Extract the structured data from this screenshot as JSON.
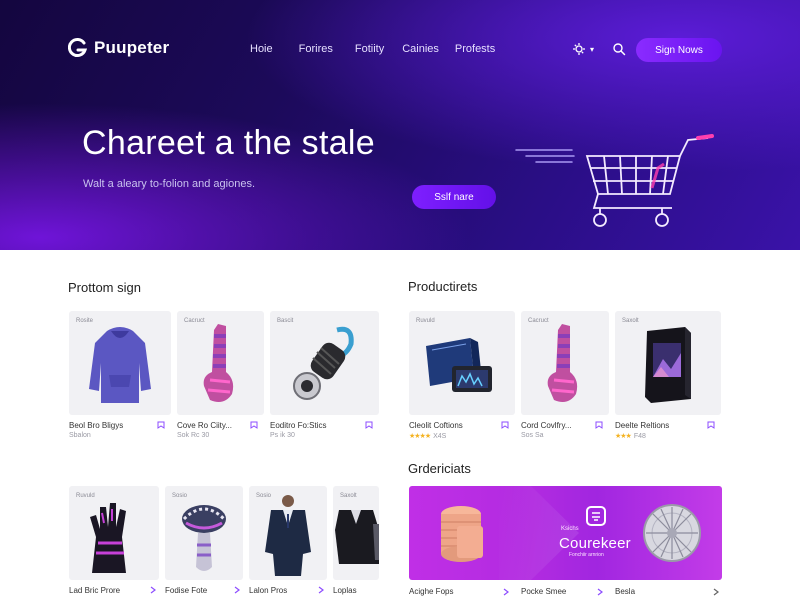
{
  "header": {
    "logo_text": "Puupeter",
    "nav": [
      "Hoie",
      "Forires",
      "Fotiity",
      "Cainies",
      "Profests"
    ],
    "signup_label": "Sign Nows",
    "icons": [
      "settings-icon",
      "chevron-down-icon",
      "search-icon"
    ]
  },
  "hero": {
    "title": "Chareet a the stale",
    "subtitle": "Walt a aleary to-folion and agiones.",
    "cta_label": "Sslf nare",
    "art": "shopping-cart-illustration"
  },
  "section1": {
    "title": "Prottom sign",
    "cards": [
      {
        "tag": "Rosite",
        "name": "Beol Bro Bligys",
        "meta": "Sbalon",
        "art": "hoodie"
      },
      {
        "tag": "Cacruct",
        "name": "Cove Ro Ciity...",
        "meta": "Sok Rc 30",
        "art": "sock"
      },
      {
        "tag": "Bascit",
        "name": "Eoditro Fo:Stics",
        "meta": "Ps ik 30",
        "art": "carabiner"
      }
    ]
  },
  "section2": {
    "title": "Productirets",
    "cards": [
      {
        "tag": "Ruvuld",
        "name": "Cleolit Coftions",
        "meta": "X4S",
        "rating": "★★★★",
        "art": "electronics-box"
      },
      {
        "tag": "Cacruct",
        "name": "Cord Covlfry...",
        "meta": "Sos Sa",
        "art": "sock"
      },
      {
        "tag": "Saxolt",
        "name": "Deelte Reltions",
        "meta": "F48",
        "rating": "★★★",
        "art": "product-box"
      }
    ]
  },
  "section3": {
    "title": "Grdericiats",
    "cards": [
      {
        "tag": "Ruvuld",
        "name": "Lad Bric Prore",
        "art": "gloves"
      },
      {
        "tag": "Sosio",
        "name": "Fodise Fote",
        "art": "beanie"
      },
      {
        "tag": "Sosio",
        "name": "Lalon Pros",
        "art": "suit"
      },
      {
        "tag": "Saxolt",
        "name": "Loplas",
        "art": "jacket"
      }
    ]
  },
  "promo": {
    "brand_small": "Ksichs",
    "brand": "Courekeer",
    "brand_tag": "Fonchiir arnrion",
    "captions": [
      "Acighe Fops",
      "Pocke Smee",
      "Besla"
    ]
  },
  "colors": {
    "hero_dark": "#14063f",
    "hero_purple": "#3a12a8",
    "accent": "#7e1fff",
    "promo": "#b12be0",
    "star": "#f4b323"
  }
}
